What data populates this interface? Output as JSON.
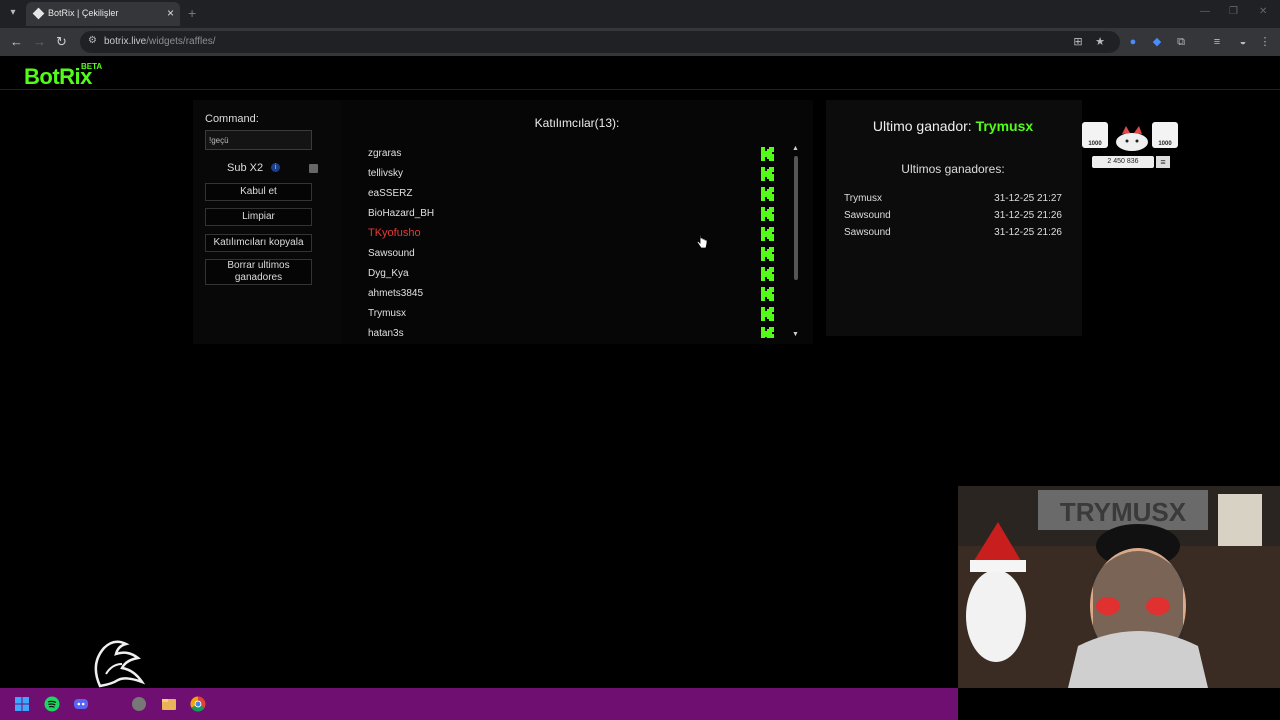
{
  "browser": {
    "tab_title": "BotRix | Çekilişler",
    "url_host": "botrix.live",
    "url_path": "/widgets/raffles/"
  },
  "brand": {
    "name": "BotRix",
    "badge": "BETA",
    "color": "#53fc18"
  },
  "controls": {
    "command_label": "Command:",
    "command_value": "!geçü",
    "sub_label": "Sub X2",
    "sub_checked": false,
    "buttons": {
      "accept": "Kabul et",
      "clear": "Limpiar",
      "copy": "Katılımcıları kopyala",
      "delete_winners": "Borrar ultimos ganadores"
    }
  },
  "participants": {
    "title": "Katılımcılar(13):",
    "items": [
      {
        "name": "zgraras"
      },
      {
        "name": "tellivsky"
      },
      {
        "name": "eaSSERZ"
      },
      {
        "name": "BioHazard_BH"
      },
      {
        "name": "TKyofusho",
        "highlight": true
      },
      {
        "name": "Sawsound"
      },
      {
        "name": "Dyg_Kya"
      },
      {
        "name": "ahmets3845"
      },
      {
        "name": "Trymusx"
      },
      {
        "name": "hatan3s"
      }
    ]
  },
  "winners": {
    "last_winner_label": "Ultimo ganador:",
    "last_winner": "Trymusx",
    "recent_label": "Ultimos ganadores:",
    "items": [
      {
        "name": "Trymusx",
        "date": "31-12-25 21:27"
      },
      {
        "name": "Sawsound",
        "date": "31-12-25 21:26"
      },
      {
        "name": "Sawsound",
        "date": "31-12-25 21:26"
      }
    ]
  },
  "overlay": {
    "left_value": "1000",
    "right_value": "1000",
    "count": "2 450 836"
  },
  "webcam": {
    "banner": "TRYMUSX"
  },
  "colors": {
    "accent": "#53fc18",
    "highlight": "#e53935",
    "taskbar": "#6f0f71"
  }
}
